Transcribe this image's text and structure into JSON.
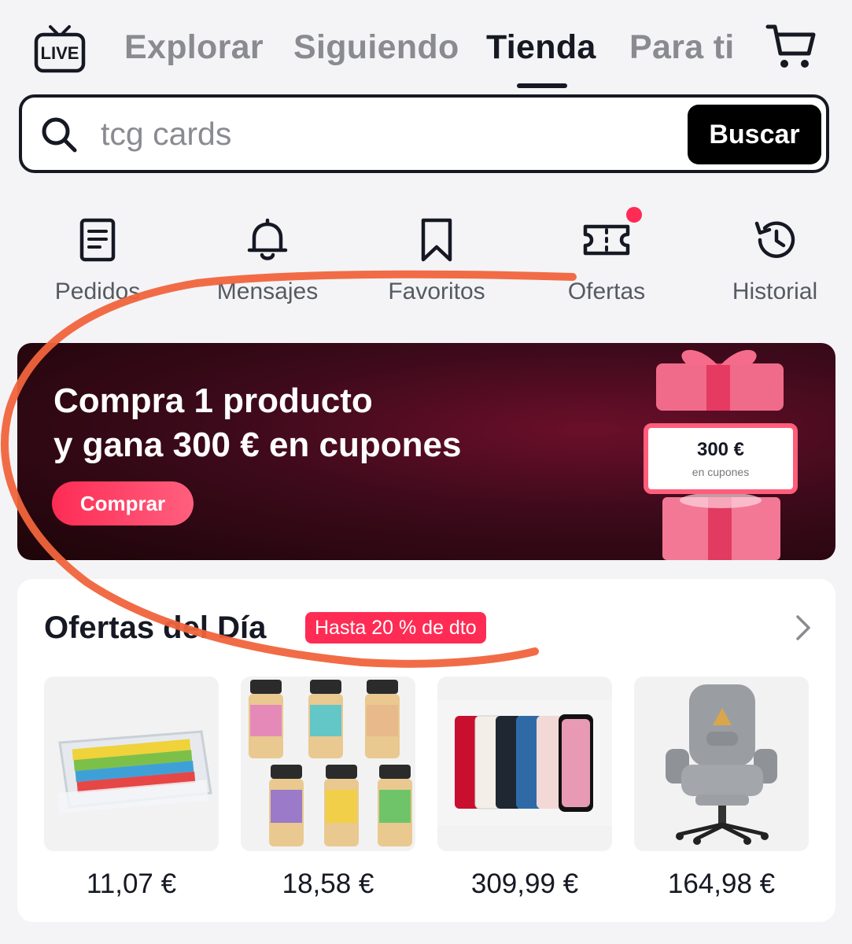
{
  "nav": {
    "live_label": "LIVE",
    "tabs": [
      "Explorar",
      "Siguiendo",
      "Tienda",
      "Para ti"
    ],
    "active_tab": "Tienda"
  },
  "search": {
    "placeholder": "tcg cards",
    "button_label": "Buscar"
  },
  "shortcuts": [
    {
      "label": "Pedidos",
      "icon": "orders-icon"
    },
    {
      "label": "Mensajes",
      "icon": "bell-icon"
    },
    {
      "label": "Favoritos",
      "icon": "bookmark-icon"
    },
    {
      "label": "Ofertas",
      "icon": "ticket-icon",
      "notification_dot": true
    },
    {
      "label": "Historial",
      "icon": "history-icon"
    }
  ],
  "banner": {
    "line1": "Compra 1 producto",
    "line2": "y gana 300 € en cupones",
    "button_label": "Comprar",
    "coupon_amount": "300 €",
    "coupon_sub": "en cupones"
  },
  "deals": {
    "title": "Ofertas del Día",
    "badge": "Hasta 20 % de dto",
    "products": [
      {
        "name": "candy-sticks",
        "price": "11,07 €"
      },
      {
        "name": "seasoning-jars",
        "price": "18,58 €"
      },
      {
        "name": "smartphones",
        "price": "309,99 €"
      },
      {
        "name": "office-chair",
        "price": "164,98 €"
      }
    ]
  },
  "colors": {
    "accent": "#fe2c55",
    "text": "#161823",
    "muted": "#8a8b91",
    "scribble": "#f0643c"
  }
}
